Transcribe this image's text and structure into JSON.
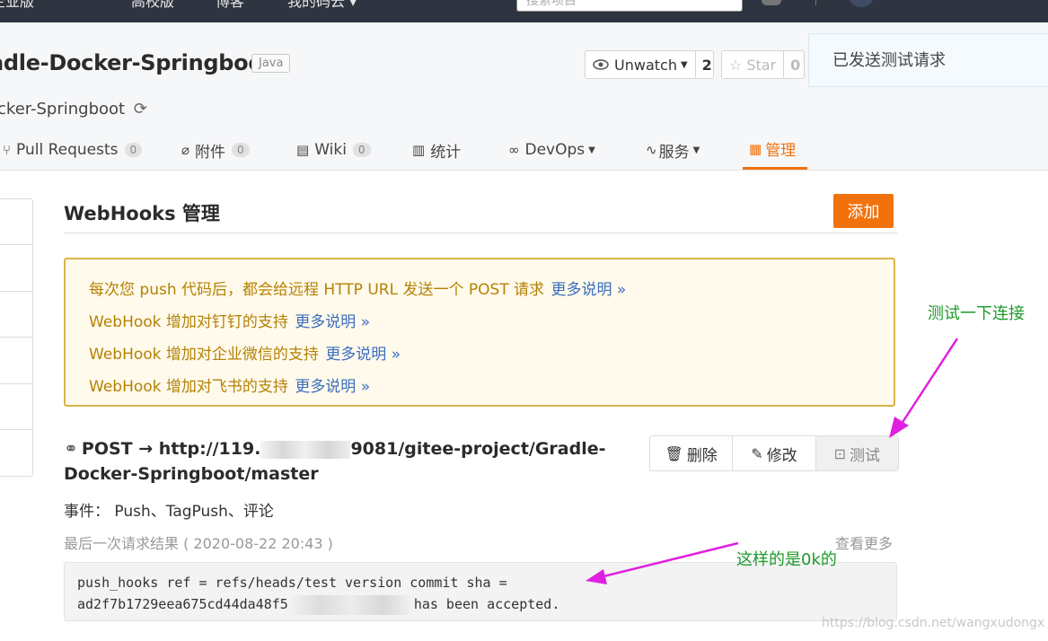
{
  "topnav": {
    "items": [
      "企业版",
      "高校版",
      "博客",
      "我的码云 ▾"
    ],
    "search_placeholder": "搜索项目"
  },
  "repo": {
    "title": "adle-Docker-Springboot",
    "language": "Java",
    "fork_from": "ocker-Springboot",
    "unwatch_label": "Unwatch",
    "unwatch_count": "2",
    "star_label": "Star",
    "star_count": "0"
  },
  "toast": {
    "message": "已发送测试请求"
  },
  "tabs": [
    {
      "label": "Pull Requests",
      "badge": "0"
    },
    {
      "label": "附件",
      "badge": "0"
    },
    {
      "label": "Wiki",
      "badge": "0"
    },
    {
      "label": "统计"
    },
    {
      "label": "DevOps"
    },
    {
      "label": "服务"
    },
    {
      "label": "管理"
    }
  ],
  "main": {
    "title": "WebHooks 管理",
    "add_button": "添加",
    "notice": [
      {
        "text": "每次您 push 代码后，都会给远程 HTTP URL 发送一个 POST 请求",
        "more": "更多说明 »"
      },
      {
        "text": "WebHook 增加对钉钉的支持",
        "more": "更多说明 »"
      },
      {
        "text": "WebHook 增加对企业微信的支持",
        "more": "更多说明 »"
      },
      {
        "text": "WebHook 增加对飞书的支持",
        "more": "更多说明 »"
      }
    ],
    "hook": {
      "url_prefix": "POST → http://119.",
      "url_suffix": "9081/gitee-project/Gradle-Docker-Springboot/master",
      "delete": "删除",
      "edit": "修改",
      "test": "测试",
      "events": "事件：  Push、TagPush、评论",
      "last_result": "最后一次请求结果 ( 2020-08-22 20:43 )",
      "see_more": "查看更多",
      "result_line1": "push_hooks ref = refs/heads/test version commit sha =",
      "result_line2_a": "ad2f7b1729eea675cd44da48f5",
      "result_line2_b": "has been accepted."
    }
  },
  "annotations": {
    "test_connection": "测试一下连接",
    "ok_note": "这样的是0k的",
    "color": "#e020e0"
  },
  "watermark": "https://blog.csdn.net/wangxudongx"
}
